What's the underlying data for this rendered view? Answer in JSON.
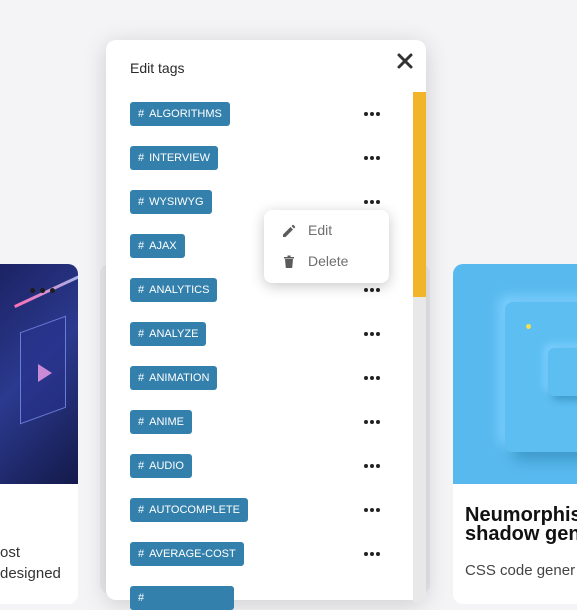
{
  "modal": {
    "title": "Edit tags",
    "close_icon": "close-icon"
  },
  "tags": [
    {
      "label": "ALGORITHMS"
    },
    {
      "label": "INTERVIEW"
    },
    {
      "label": "WYSIWYG"
    },
    {
      "label": "AJAX"
    },
    {
      "label": "ANALYTICS"
    },
    {
      "label": "ANALYZE"
    },
    {
      "label": "ANIMATION"
    },
    {
      "label": "ANIME"
    },
    {
      "label": "AUDIO"
    },
    {
      "label": "AUTOCOMPLETE"
    },
    {
      "label": "AVERAGE-COST"
    },
    {
      "label": ""
    }
  ],
  "tag_prefix": "#",
  "context_menu": {
    "edit_label": "Edit",
    "edit_icon": "pencil-icon",
    "delete_label": "Delete",
    "delete_icon": "trash-icon"
  },
  "background": {
    "left_card_text_1": "ost",
    "left_card_text_2": "designed",
    "right_card_title_1": "Neumorphis",
    "right_card_title_2": "shadow gen",
    "right_card_desc": "CSS code gener"
  },
  "colors": {
    "tag_bg": "#3480ac",
    "scroll_thumb": "#f2b52a",
    "right_card_bg": "#58b9ee"
  }
}
